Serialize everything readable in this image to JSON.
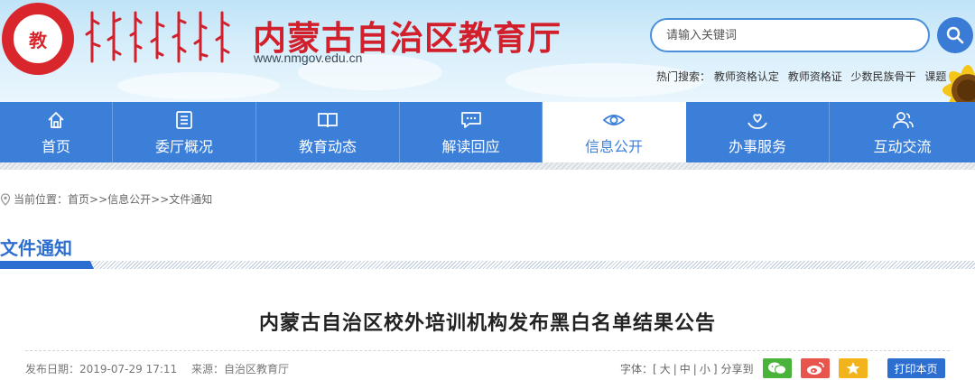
{
  "header": {
    "emblem_glyph": "教",
    "title": "内蒙古自治区教育厅",
    "url": "www.nmgov.edu.cn",
    "title_color": "#d1202b"
  },
  "search": {
    "placeholder": "请输入关键词",
    "button_icon": "search-icon"
  },
  "hot_search": {
    "label": "热门搜索：",
    "items": [
      "教师资格认定",
      "教师资格证",
      "少数民族骨干",
      "课题"
    ]
  },
  "nav": {
    "accent_color": "#3c7fd9",
    "items": [
      {
        "label": "首页",
        "icon": "home-icon"
      },
      {
        "label": "委厅概况",
        "icon": "list-icon"
      },
      {
        "label": "教育动态",
        "icon": "book-icon"
      },
      {
        "label": "解读回应",
        "icon": "chat-icon"
      },
      {
        "label": "信息公开",
        "icon": "eye-icon",
        "active": true
      },
      {
        "label": "办事服务",
        "icon": "hands-icon"
      },
      {
        "label": "互动交流",
        "icon": "users-icon"
      }
    ]
  },
  "breadcrumb": {
    "prefix": "当前位置：",
    "items": [
      "首页",
      "信息公开",
      "文件通知"
    ],
    "separator": ">>"
  },
  "section": {
    "title": "文件通知"
  },
  "article": {
    "title": "内蒙古自治区校外培训机构发布黑白名单结果公告",
    "date_label": "发布日期：",
    "date": "2019-07-29 17:11",
    "source_label": "来源：",
    "source": "自治区教育厅"
  },
  "toolbar": {
    "font_label": "字体：",
    "font_large": "大",
    "font_medium": "中",
    "font_small": "小",
    "share_label": "分享到",
    "share": [
      {
        "name": "wechat-icon",
        "color": "#49b33b"
      },
      {
        "name": "weibo-icon",
        "color": "#e8554d"
      },
      {
        "name": "qzone-icon",
        "color": "#f3b31a"
      }
    ],
    "print_label": "打印本页"
  }
}
